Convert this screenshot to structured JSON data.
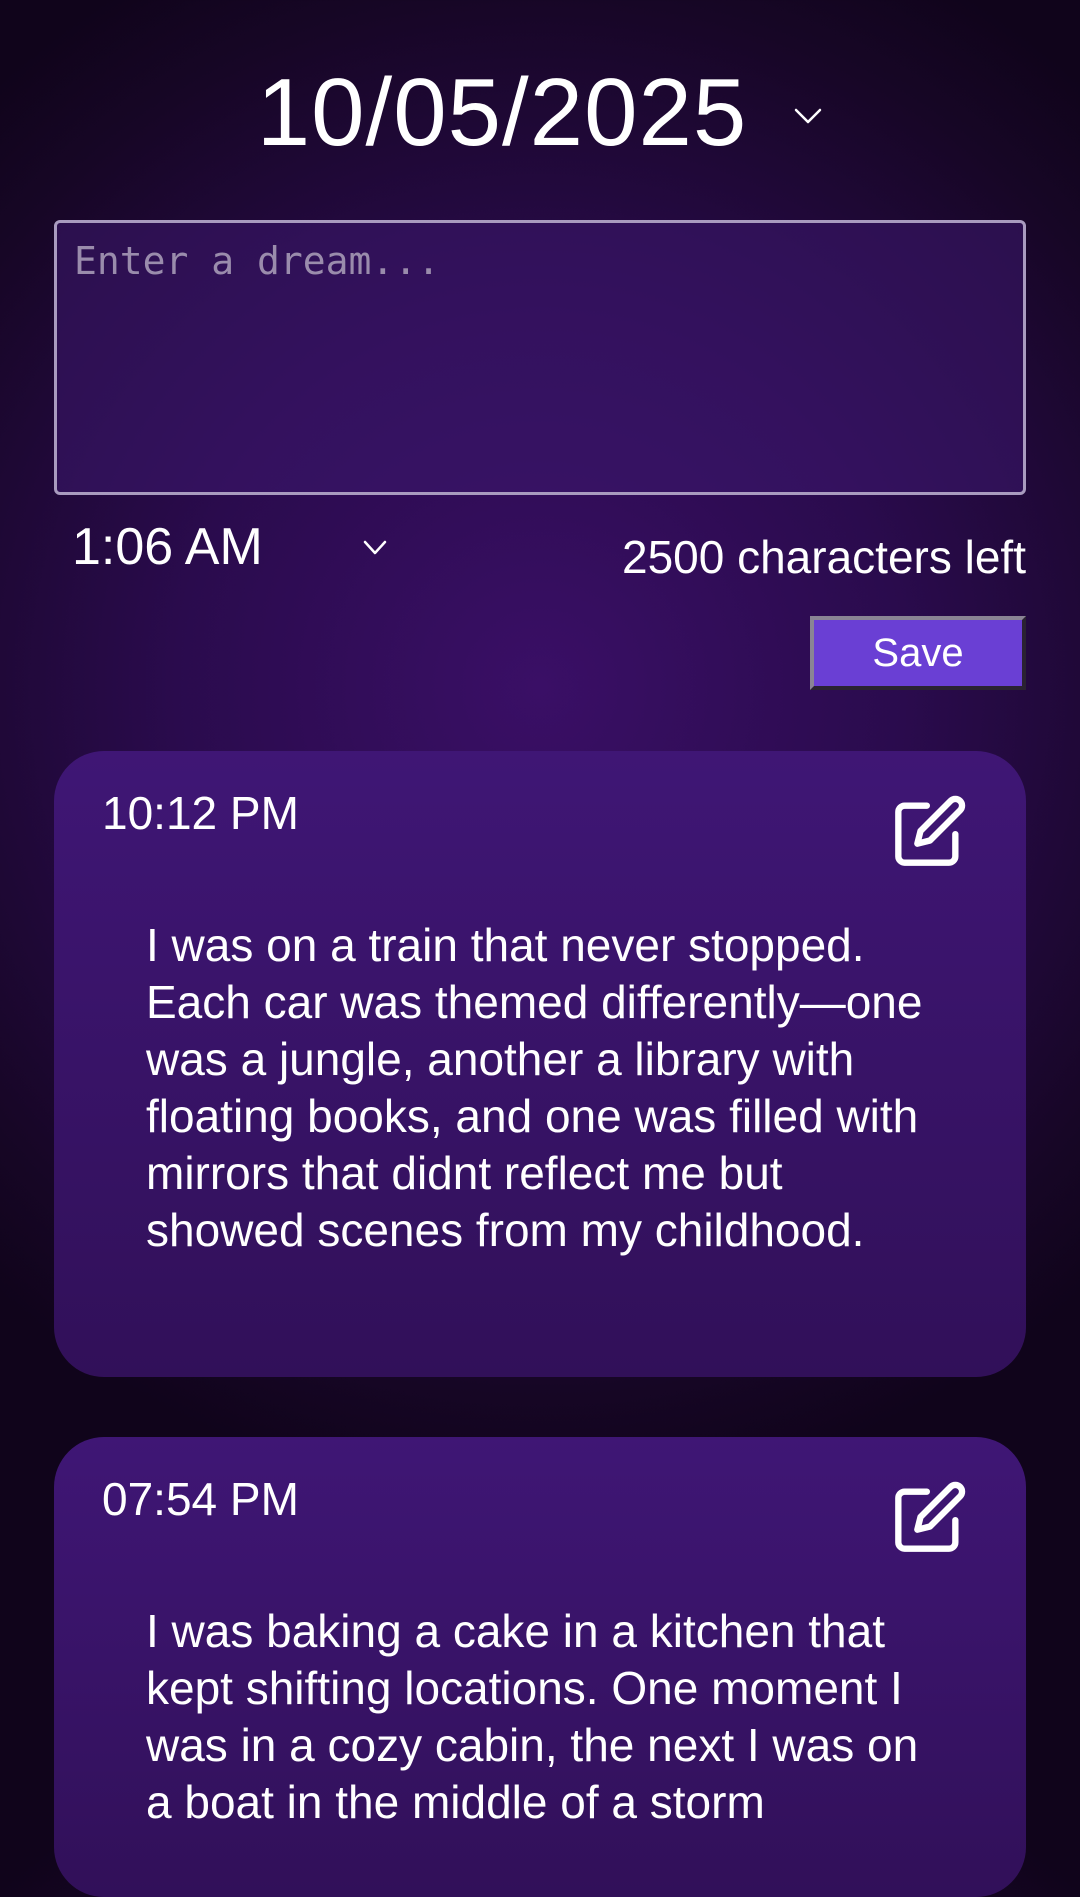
{
  "header": {
    "date": "10/05/2025"
  },
  "composer": {
    "placeholder": "Enter a dream...",
    "value": "",
    "time": "1:06 AM",
    "chars_left": "2500 characters left",
    "save_label": "Save"
  },
  "entries": [
    {
      "time": "10:12 PM",
      "text": "I was on a train that never stopped. Each car was themed differently—one was a jungle, another a library with floating books, and one was filled with mirrors that didnt reflect me but showed scenes from my childhood.",
      "icon": "edit-icon"
    },
    {
      "time": "07:54 PM",
      "text": "I was baking a cake in a kitchen that kept shifting locations. One moment I was in a cozy cabin, the next I was on a boat in the middle of a storm",
      "icon": "edit-icon"
    }
  ],
  "colors": {
    "accent": "#6a3fd4",
    "card": "#3a1470",
    "background": "#2a0b4d"
  }
}
